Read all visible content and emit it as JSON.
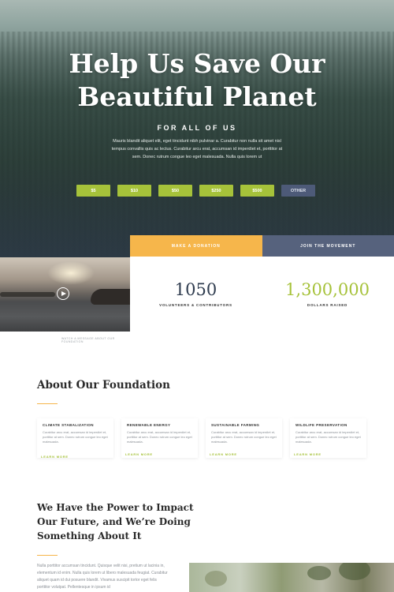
{
  "hero": {
    "title_line1": "Help Us Save Our",
    "title_line2": "Beautiful Planet",
    "kicker": "FOR ALL OF US",
    "text": "Mauris blandit aliquet elit, eget tincidunt nibh pulvinar a. Curabitur non nulla sit amet nisl tempus convallis quis ac lectus. Curabitur arcu erat, accumsan id imperdiet et, porttitor at sem. Donec rutrum congue leo eget malesuada. Nulla quis lorem ut",
    "amounts": [
      "$5",
      "$10",
      "$50",
      "$250",
      "$500"
    ],
    "other_label": "OTHER"
  },
  "tabs": {
    "donate": "MAKE A DONATION",
    "join": "JOIN THE MOVEMENT"
  },
  "video": {
    "caption": "WATCH A MESSAGE ABOUT OUR FOUNDATION"
  },
  "stats": [
    {
      "value": "1050",
      "label": "VOLUNTEERS & CONTRIBUTORS"
    },
    {
      "value": "1,300,000",
      "label": "DOLLARS RAISED"
    }
  ],
  "about": {
    "title": "About Our Foundation",
    "cards": [
      {
        "title": "CLIMATE STABALIZATION",
        "text": "Curabitur arcu erat, accumsan id imperdiet et, porttitor at sem. Donec rutrum congue leo eget malesuada.",
        "link": "LEARN MORE"
      },
      {
        "title": "RENEWABLE ENERGY",
        "text": "Curabitur arcu erat, accumsan id imperdiet et, porttitor at sem. Donec rutrum congue leo eget malesuada.",
        "link": "LEARN MORE"
      },
      {
        "title": "SUSTAINABLE FARMING",
        "text": "Curabitur arcu erat, accumsan id imperdiet et, porttitor at sem. Donec rutrum congue leo eget malesuada.",
        "link": "LEARN MORE"
      },
      {
        "title": "WILDLIFE PRESERVATION",
        "text": "Curabitur arcu erat, accumsan id imperdiet et, porttitor at sem. Donec rutrum congue leo eget malesuada.",
        "link": "LEARN MORE"
      }
    ]
  },
  "power": {
    "title": "We Have the Power to Impact Our Future, and We’re Doing Something About It",
    "text": "Nulla porttitor accumsan tincidunt. Quisque velit nisi, pretium ut lacinia in, elementum id enim. Nulla quis lorem ut libero malesuada feugiat. Curabitur aliquet quam id dui posuere blandit. Vivamus suscipit tortor eget felis porttitor volutpat. Pellentesque in ipsum id"
  },
  "colors": {
    "accent_green": "#a6c23a",
    "accent_orange": "#f6b64b",
    "navy": "#56627d"
  }
}
